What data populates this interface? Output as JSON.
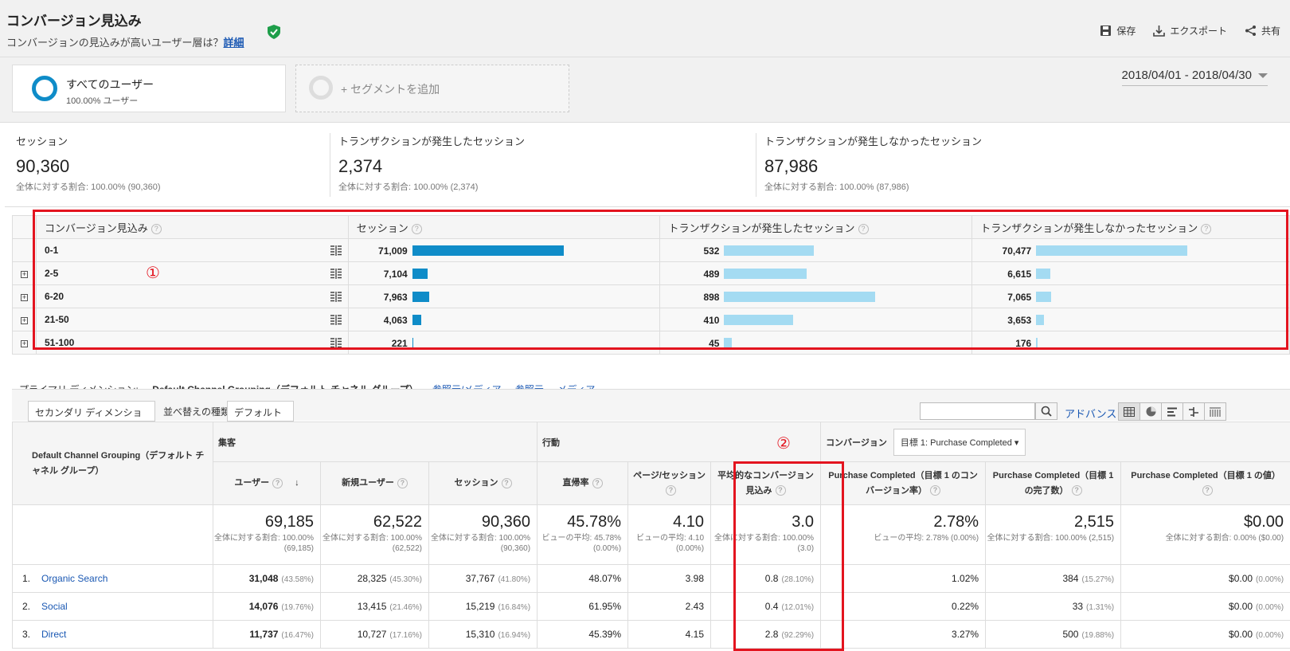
{
  "header": {
    "title": "コンバージョン見込み",
    "subtitle": "コンバージョンの見込みが高いユーザー層は？",
    "detail_link": "詳細",
    "save": "保存",
    "export": "エクスポート",
    "share": "共有"
  },
  "segments": {
    "all_users": "すべてのユーザー",
    "all_users_sub": "100.00% ユーザー",
    "add_segment": "+ セグメントを追加",
    "date_range": "2018/04/01 - 2018/04/30"
  },
  "summary": [
    {
      "label": "セッション",
      "value": "90,360",
      "sub": "全体に対する割合: 100.00% (90,360)"
    },
    {
      "label": "トランザクションが発生したセッション",
      "value": "2,374",
      "sub": "全体に対する割合: 100.00% (2,374)"
    },
    {
      "label": "トランザクションが発生しなかったセッション",
      "value": "87,986",
      "sub": "全体に対する割合: 100.00% (87,986)"
    }
  ],
  "prospect_table": {
    "headers": [
      "コンバージョン見込み",
      "セッション",
      "トランザクションが発生したセッション",
      "トランザクションが発生しなかったセッション"
    ],
    "rows": [
      {
        "label": "0-1",
        "sessions": "71,009",
        "trans": "532",
        "notrans": "70,477",
        "s_frac": 1.0,
        "t_frac": 0.59,
        "n_frac": 1.0
      },
      {
        "label": "2-5",
        "sessions": "7,104",
        "trans": "489",
        "notrans": "6,615",
        "s_frac": 0.1,
        "t_frac": 0.545,
        "n_frac": 0.094
      },
      {
        "label": "6-20",
        "sessions": "7,963",
        "trans": "898",
        "notrans": "7,065",
        "s_frac": 0.112,
        "t_frac": 1.0,
        "n_frac": 0.1
      },
      {
        "label": "21-50",
        "sessions": "4,063",
        "trans": "410",
        "notrans": "3,653",
        "s_frac": 0.057,
        "t_frac": 0.457,
        "n_frac": 0.052
      },
      {
        "label": "51-100",
        "sessions": "221",
        "trans": "45",
        "notrans": "176",
        "s_frac": 0.003,
        "t_frac": 0.05,
        "n_frac": 0.0025
      }
    ],
    "annotation": "①"
  },
  "dimension": {
    "primary_label": "プライマリ ディメンション:",
    "primary_value": "Default Channel Grouping（デフォルト チャネル グループ）",
    "alt1": "参照元/メディア",
    "alt2": "参照元",
    "alt3": "メディア",
    "secondary": "セカンダリ ディメンション",
    "sort_label": "並べ替えの種類:",
    "sort_value": "デフォルト",
    "advanced": "アドバンス"
  },
  "data_table": {
    "dim_header": "Default Channel Grouping（デフォルト チャネル グループ）",
    "group_acq": "集客",
    "group_beh": "行動",
    "group_conv": "コンバージョン",
    "goal_select": "目標 1: Purchase Completed",
    "annotation": "②",
    "cols": [
      "ユーザー",
      "新規ユーザー",
      "セッション",
      "直帰率",
      "ページ/セッション",
      "平均的なコンバージョン見込み",
      "Purchase Completed（目標 1 のコンバージョン率）",
      "Purchase Completed（目標 1 の完了数）",
      "Purchase Completed（目標 1 の値）"
    ],
    "totals": [
      {
        "v": "69,185",
        "s": "全体に対する割合: 100.00% (69,185)"
      },
      {
        "v": "62,522",
        "s": "全体に対する割合: 100.00% (62,522)"
      },
      {
        "v": "90,360",
        "s": "全体に対する割合: 100.00% (90,360)"
      },
      {
        "v": "45.78%",
        "s": "ビューの平均: 45.78% (0.00%)"
      },
      {
        "v": "4.10",
        "s": "ビューの平均: 4.10 (0.00%)"
      },
      {
        "v": "3.0",
        "s": "全体に対する割合: 100.00% (3.0)"
      },
      {
        "v": "2.78%",
        "s": "ビューの平均: 2.78% (0.00%)"
      },
      {
        "v": "2,515",
        "s": "全体に対する割合: 100.00% (2,515)"
      },
      {
        "v": "$0.00",
        "s": "全体に対する割合: 0.00% ($0.00)"
      }
    ],
    "rows": [
      {
        "idx": "1.",
        "name": "Organic Search",
        "users": "31,048",
        "users_p": "(43.58%)",
        "newu": "28,325",
        "newu_p": "(45.30%)",
        "sess": "37,767",
        "sess_p": "(41.80%)",
        "bounce": "48.07%",
        "pps": "3.98",
        "avg": "0.8",
        "avg_p": "(28.10%)",
        "cr": "1.02%",
        "comp": "384",
        "comp_p": "(15.27%)",
        "val": "$0.00",
        "val_p": "(0.00%)"
      },
      {
        "idx": "2.",
        "name": "Social",
        "users": "14,076",
        "users_p": "(19.76%)",
        "newu": "13,415",
        "newu_p": "(21.46%)",
        "sess": "15,219",
        "sess_p": "(16.84%)",
        "bounce": "61.95%",
        "pps": "2.43",
        "avg": "0.4",
        "avg_p": "(12.01%)",
        "cr": "0.22%",
        "comp": "33",
        "comp_p": "(1.31%)",
        "val": "$0.00",
        "val_p": "(0.00%)"
      },
      {
        "idx": "3.",
        "name": "Direct",
        "users": "11,737",
        "users_p": "(16.47%)",
        "newu": "10,727",
        "newu_p": "(17.16%)",
        "sess": "15,310",
        "sess_p": "(16.94%)",
        "bounce": "45.39%",
        "pps": "4.15",
        "avg": "2.8",
        "avg_p": "(92.29%)",
        "cr": "3.27%",
        "comp": "500",
        "comp_p": "(19.88%)",
        "val": "$0.00",
        "val_p": "(0.00%)"
      }
    ]
  },
  "colors": {
    "accent_red": "#e3141f",
    "bar_dark": "#0f8cc8",
    "bar_light": "#a4dbf2",
    "link": "#1a58b3"
  }
}
